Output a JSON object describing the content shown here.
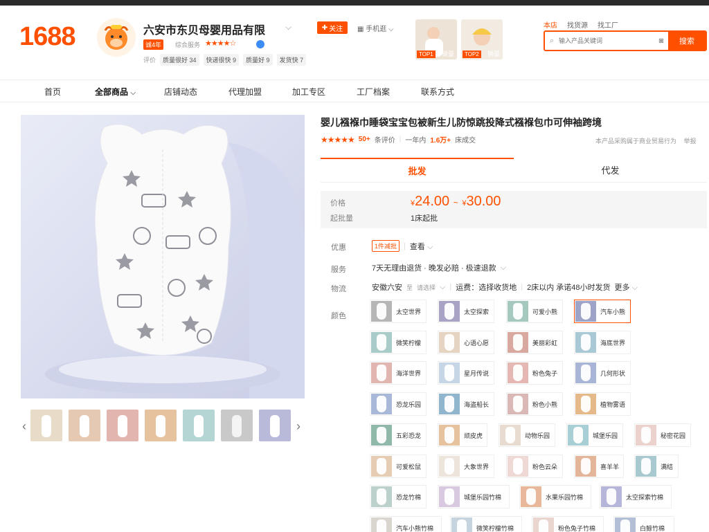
{
  "header": {
    "logo": "1688",
    "shop_name": "六安市东贝母婴用品有限",
    "follow_label": "关注",
    "mobile_label": "手机逛",
    "years_badge": "诚4年",
    "service_label": "综合服务",
    "service_stars": "★★★★☆",
    "ratings_label": "评价",
    "ratings": [
      "质量很好 34",
      "快递很快 9",
      "质量好 9",
      "发货快 7"
    ],
    "top_products": [
      {
        "caption": "TOP1",
        "label": "销量"
      },
      {
        "caption": "TOP2",
        "label": "销量"
      }
    ]
  },
  "search": {
    "tabs": [
      "本店",
      "找货源",
      "找工厂"
    ],
    "placeholder": "输入产品关键词",
    "button": "搜索"
  },
  "nav": [
    "首页",
    "全部商品",
    "店铺动态",
    "代理加盟",
    "加工专区",
    "工厂档案",
    "联系方式"
  ],
  "product": {
    "title": "婴儿襁褓巾睡袋宝宝包被新生儿防惊跳投降式襁褓包巾可伸袖跨境",
    "stars": "★★★★★",
    "review_count": "50+",
    "review_label": "条评价",
    "sales_prefix": "一年内",
    "sales_count": "1.6万+",
    "sales_suffix": "床成交",
    "biz_note": "本产品采购属于商业贸易行为",
    "biz_note2": "举报",
    "tabs": [
      "批发",
      "代发"
    ],
    "price_label": "价格",
    "price_currency": "¥",
    "price_low": "24.00",
    "price_sep": "~",
    "price_high": "30.00",
    "moq_label": "起批量",
    "moq": "1床起批",
    "discount_label": "优惠",
    "discount_coupon": "1件减批",
    "discount_view": "查看",
    "service_label2": "服务",
    "service_text": "7天无理由退货 · 晚发必赔 · 极速退款",
    "logistics_label": "物流",
    "logistics_from": "安徽六安",
    "logistics_to": "至",
    "logistics_select": "请选择",
    "logistics_fee": "运费：选择收货地",
    "logistics_promise": "2床以内 承诺48小时发货",
    "logistics_more": "更多",
    "color_label": "颜色"
  },
  "colors": [
    {
      "name": "太空世界",
      "color": "#b6b6b6"
    },
    {
      "name": "太空探索",
      "color": "#a9a3c6"
    },
    {
      "name": "可爱小熊",
      "color": "#a6c9bf"
    },
    {
      "name": "汽车小熊",
      "color": "#9ea4c8"
    },
    {
      "name": "微笑柠檬",
      "color": "#a9ccc9"
    },
    {
      "name": "心语心愿",
      "color": "#e6d4c2"
    },
    {
      "name": "美丽彩虹",
      "color": "#d9a9a0"
    },
    {
      "name": "海底世界",
      "color": "#a9c9d6"
    },
    {
      "name": "海洋世界",
      "color": "#e2b6b0"
    },
    {
      "name": "星月传说",
      "color": "#c7d6e6"
    },
    {
      "name": "粉色兔子",
      "color": "#e4b7b3"
    },
    {
      "name": "几何形状",
      "color": "#a9b5d6"
    },
    {
      "name": "恐龙乐园",
      "color": "#a9b7d9"
    },
    {
      "name": "海盗船长",
      "color": "#8fb6cc"
    },
    {
      "name": "粉色小熊",
      "color": "#d9b8b5"
    },
    {
      "name": "植物雾语",
      "color": "#e6b98a"
    },
    {
      "name": "五彩恐龙",
      "color": "#90b9a9"
    },
    {
      "name": "顽皮虎",
      "color": "#e6c39e"
    },
    {
      "name": "动物乐园",
      "color": "#e7dccf"
    },
    {
      "name": "城堡乐园",
      "color": "#a9cfd6"
    },
    {
      "name": "秘密花园",
      "color": "#ecd2cd"
    },
    {
      "name": "可爱松鼠",
      "color": "#e6ccb3"
    },
    {
      "name": "大象世界",
      "color": "#ede5dc"
    },
    {
      "name": "粉色云朵",
      "color": "#efd9d6"
    },
    {
      "name": "喜羊羊",
      "color": "#e3b69a"
    },
    {
      "name": "满结",
      "color": "#a9c9d0"
    },
    {
      "name": "恐龙竹棉",
      "color": "#bcd0cc"
    },
    {
      "name": "城堡乐园竹棉",
      "color": "#d8c9e0"
    },
    {
      "name": "水果乐园竹棉",
      "color": "#e9b89a"
    },
    {
      "name": "太空探索竹棉",
      "color": "#b5b6d9"
    },
    {
      "name": "汽车小熊竹棉",
      "color": "#d9d5cf"
    },
    {
      "name": "微笑柠檬竹棉",
      "color": "#c6d4df"
    },
    {
      "name": "粉色兔子竹棉",
      "color": "#ead6cf"
    },
    {
      "name": "白鲸竹棉",
      "color": "#b3bfd6"
    }
  ],
  "thumbs": [
    {
      "color": "#e8dcc9"
    },
    {
      "color": "#e6c9b3"
    },
    {
      "color": "#e2b5ae"
    },
    {
      "color": "#e6c29e"
    },
    {
      "color": "#b5d5d5"
    },
    {
      "color": "#c9c9c9"
    },
    {
      "color": "#b9b9d9"
    }
  ]
}
